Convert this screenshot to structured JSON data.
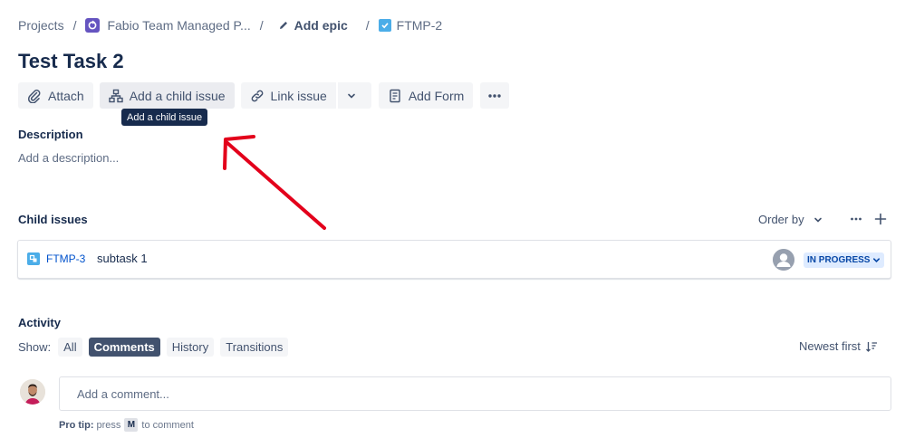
{
  "breadcrumb": {
    "projects": "Projects",
    "project_name": "Fabio Team Managed P...",
    "epic": "Add epic",
    "issue_key": "FTMP-2",
    "separator": "/"
  },
  "issue": {
    "title": "Test Task 2"
  },
  "toolbar": {
    "attach": "Attach",
    "add_child": "Add a child issue",
    "link_issue": "Link issue",
    "add_form": "Add Form"
  },
  "tooltip": {
    "text": "Add a child issue"
  },
  "description": {
    "heading": "Description",
    "placeholder": "Add a description..."
  },
  "child_issues": {
    "heading": "Child issues",
    "order_by": "Order by",
    "items": [
      {
        "key": "FTMP-3",
        "summary": "subtask 1",
        "status": "IN PROGRESS"
      }
    ]
  },
  "activity": {
    "heading": "Activity",
    "show_label": "Show:",
    "filters": [
      "All",
      "Comments",
      "History",
      "Transitions"
    ],
    "selected_filter": "Comments",
    "sort": "Newest first",
    "comment_placeholder": "Add a comment...",
    "protip_prefix": "Pro tip:",
    "protip_press": "press",
    "protip_key": "M",
    "protip_suffix": "to comment"
  },
  "colors": {
    "project_icon": "#6554c0",
    "task_icon": "#4bade8",
    "link": "#0052cc",
    "status_bg": "#deebff",
    "status_text": "#0747a6",
    "annotation_arrow": "#e3001b"
  },
  "icons": {
    "project": "project-icon",
    "edit": "pencil-icon",
    "task": "task-checkbox-icon",
    "attach": "paperclip-icon",
    "child": "hierarchy-icon",
    "link": "link-icon",
    "form": "form-icon",
    "more": "more-icon"
  }
}
